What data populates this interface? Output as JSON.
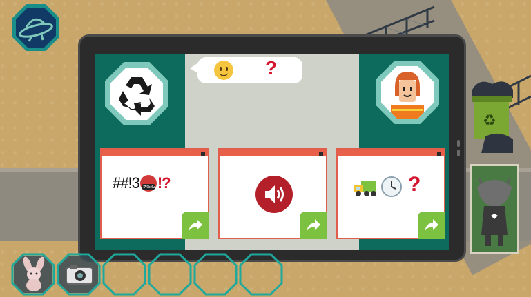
{
  "dialog": {
    "speech_emoji": "smiley-face",
    "speech_question": "?",
    "left_avatar": "recycle-icon",
    "right_avatar": "worker-avatar"
  },
  "cards": [
    {
      "text_main": "##!3",
      "emoji_label": "#%!&",
      "text_end": "!?",
      "action": "arrow-right-icon"
    },
    {
      "icon": "speaker-icon",
      "action": "arrow-right-icon"
    },
    {
      "icons": [
        "truck-icon",
        "clock-icon"
      ],
      "question": "?",
      "action": "arrow-right-icon"
    }
  ],
  "inventory": {
    "slots": [
      "rabbit-toy",
      "camera",
      "",
      "",
      "",
      ""
    ]
  },
  "colors": {
    "teal_dark": "#0d6b5e",
    "teal_mid": "#2a8a78",
    "accent_red": "#d4162e",
    "card_border": "#e15e4c",
    "arrow_green": "#7cc240"
  }
}
